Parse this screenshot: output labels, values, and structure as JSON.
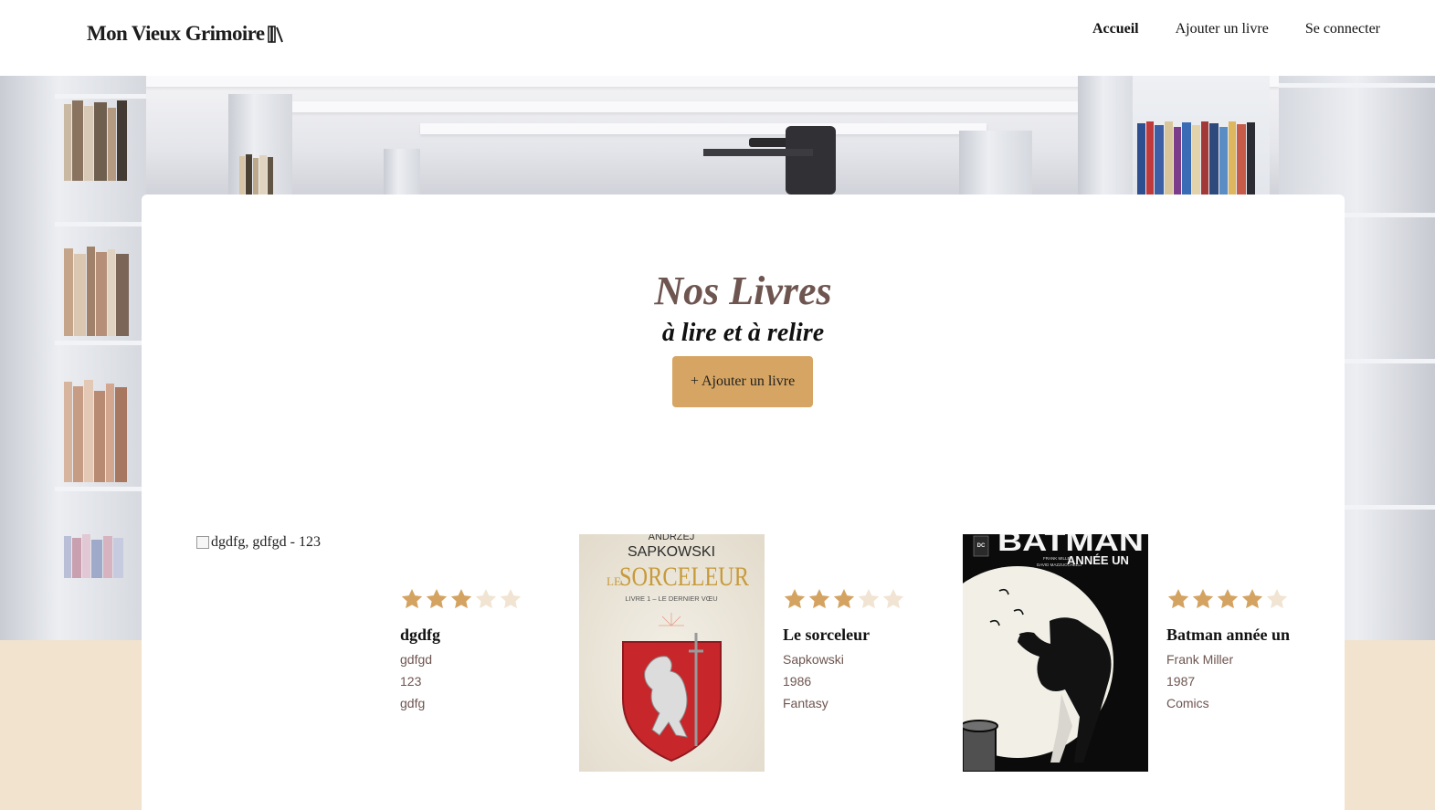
{
  "header": {
    "brand": "Mon Vieux Grimoire",
    "nav": [
      {
        "label": "Accueil",
        "active": true
      },
      {
        "label": "Ajouter un livre",
        "active": false
      },
      {
        "label": "Se connecter",
        "active": false
      }
    ]
  },
  "main": {
    "title": "Nos Livres",
    "subtitle": "à lire et à relire",
    "add_button": "+ Ajouter un livre"
  },
  "books": [
    {
      "cover_alt": "dgdfg, gdfgd - 123",
      "rating": 3,
      "title": "dgdfg",
      "author": "gdfgd",
      "year": "123",
      "genre": "gdfg",
      "cover": "broken"
    },
    {
      "rating": 3,
      "title": "Le sorceleur",
      "author": "Sapkowski",
      "year": "1986",
      "genre": "Fantasy",
      "cover": "sorceleur",
      "cover_text": {
        "author": "ANDRZEJ",
        "author2": "SAPKOWSKI",
        "le": "LE",
        "name": "SORCELEUR",
        "tome": "LIVRE 1 – LE DERNIER VŒU"
      }
    },
    {
      "rating": 4,
      "title": "Batman année un",
      "author": "Frank Miller",
      "year": "1987",
      "genre": "Comics",
      "cover": "batman",
      "cover_text": {
        "name": "BATMAN",
        "sub": "ANNÉE UN",
        "credits1": "FRANK MILLER",
        "credits2": "DAVID MAZZUCCHELLI",
        "badge": "DC"
      }
    }
  ],
  "colors": {
    "accent": "#d6a563",
    "star_on": "#d4a361",
    "star_off": "#f1e4d2",
    "title": "#6e5550",
    "beige": "#f2e3cf"
  },
  "icons": {
    "brand": "book-spines-icon",
    "star": "star-icon",
    "broken_image": "broken-image-icon"
  }
}
